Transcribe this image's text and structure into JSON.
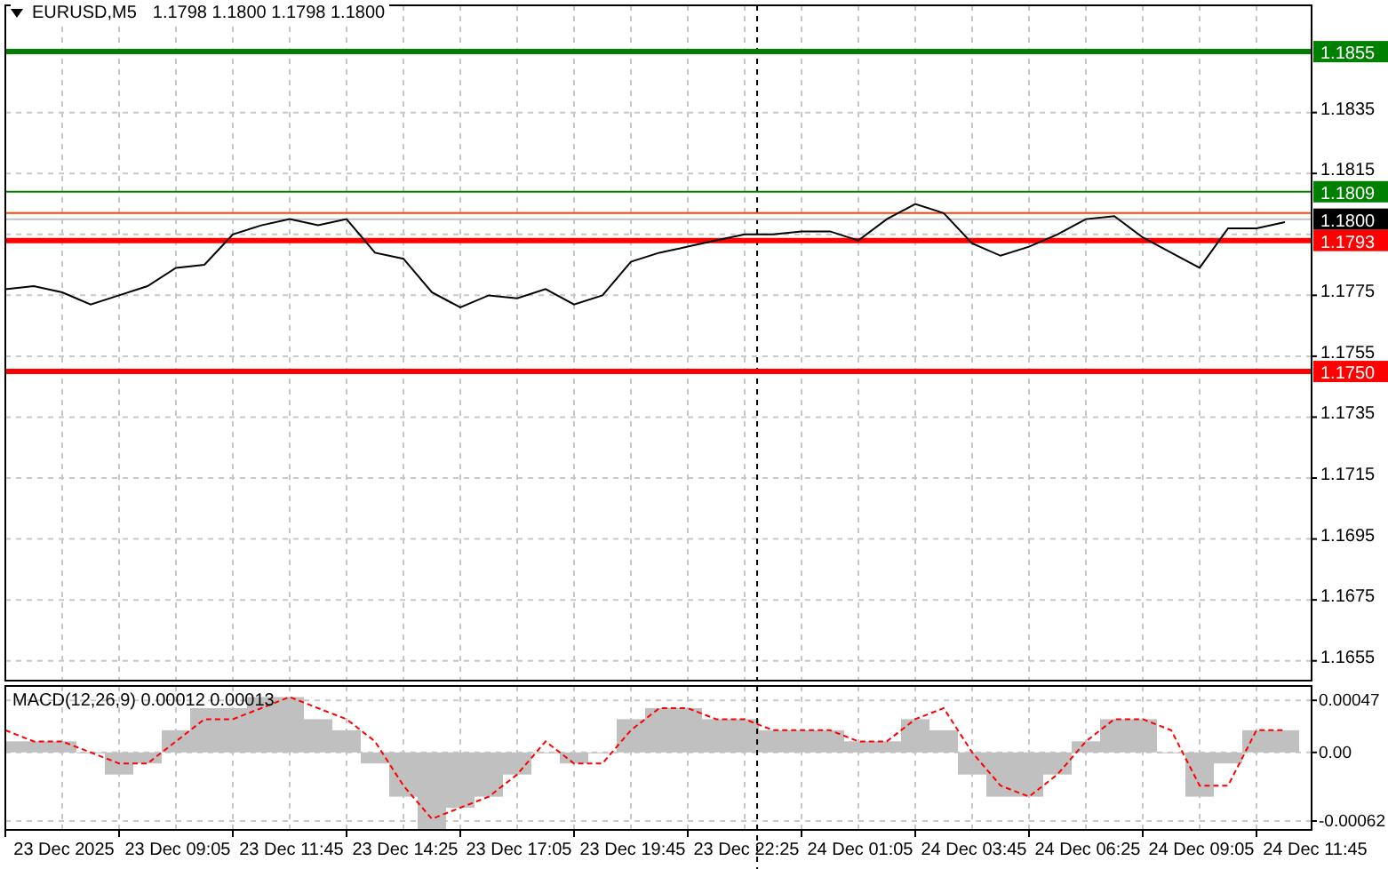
{
  "main": {
    "header": {
      "symbol": "EURUSD,M5",
      "quote": "1.1798 1.1800 1.1798 1.1800"
    },
    "price_labels": [
      {
        "text": "1.1855",
        "color": "#008000"
      },
      {
        "text": "1.1809",
        "color": "#008000"
      },
      {
        "text": "1.1800",
        "color": "#000000"
      },
      {
        "text": "1.1793",
        "color": "#ff0000"
      },
      {
        "text": "1.1750",
        "color": "#ff0000"
      }
    ],
    "chart_data": {
      "type": "line",
      "grid": true,
      "ylim": [
        1.16485,
        1.18702
      ],
      "yticks": [
        1.1835,
        1.1815,
        1.1775,
        1.1755,
        1.1735,
        1.1715,
        1.1695,
        1.1675,
        1.1655
      ],
      "ref_lines": [
        {
          "axis": "y",
          "value": 1.1855,
          "color": "#008000"
        },
        {
          "axis": "y",
          "value": 1.1809,
          "color": "#008000"
        },
        {
          "axis": "y",
          "value": 1.1802,
          "color": "#ff4500"
        },
        {
          "axis": "y",
          "value": 1.18,
          "color": "#c0c0c0"
        },
        {
          "axis": "y",
          "value": 1.1793,
          "color": "#ff0000"
        },
        {
          "axis": "y",
          "value": 1.175,
          "color": "#ff0000"
        }
      ],
      "categories": [
        null,
        null,
        null,
        null,
        null,
        null,
        null,
        null,
        null,
        null,
        null,
        null,
        null,
        null,
        null,
        null,
        null,
        null,
        null,
        null,
        null,
        null,
        null,
        null,
        null,
        null,
        null,
        null,
        null,
        null,
        null,
        null,
        null,
        null,
        null,
        null,
        null,
        null,
        null,
        null,
        null,
        null,
        null,
        null,
        null,
        null
      ],
      "series": [
        {
          "color": "#000000",
          "values": [
            1.1777,
            1.1778,
            1.1776,
            1.1772,
            1.1775,
            1.1778,
            1.1784,
            1.1785,
            1.1795,
            1.1798,
            1.18,
            1.1798,
            1.18,
            1.1789,
            1.1787,
            1.1776,
            1.1771,
            1.1775,
            1.1774,
            1.1777,
            1.1772,
            1.1775,
            1.1786,
            1.1789,
            1.1791,
            1.1793,
            1.1795,
            1.1795,
            1.1796,
            1.1796,
            1.1793,
            1.18,
            1.1805,
            1.1802,
            1.1792,
            1.1788,
            1.1791,
            1.1795,
            1.18,
            1.1801,
            1.1794,
            1.1789,
            1.1784,
            1.1797,
            1.1797,
            1.1799
          ]
        }
      ]
    }
  },
  "indicator": {
    "chart_data": {
      "type": "bar",
      "grid": true,
      "title": "MACD(12,26,9) 0.00012 0.00013",
      "ylim": [
        -0.0007,
        0.0006
      ],
      "yticks": [
        {
          "value": 0.00047,
          "label": "0.00047"
        },
        {
          "value": 0,
          "label": "0.00"
        },
        {
          "value": -0.00062,
          "label": "-0.00062"
        }
      ],
      "categories": [
        null,
        null,
        "23 Dec 2025",
        null,
        null,
        null,
        "23 Dec 09:05",
        null,
        null,
        null,
        "23 Dec 11:45",
        null,
        null,
        null,
        "23 Dec 14:25",
        null,
        null,
        null,
        "23 Dec 17:05",
        null,
        null,
        null,
        "23 Dec 19:45",
        null,
        null,
        null,
        "23 Dec 22:25",
        null,
        null,
        null,
        "24 Dec 01:05",
        null,
        null,
        null,
        "24 Dec 03:45",
        null,
        null,
        null,
        "24 Dec 06:25",
        null,
        null,
        null,
        "24 Dec 09:05",
        null,
        null,
        null,
        "24 Dec 11:45"
      ],
      "series": [
        {
          "color": "#c0c0c0",
          "values": [
            0.0001,
            0.0001,
            0.0001,
            0,
            -0.0002,
            -0.0001,
            0.0002,
            0.0004,
            0.0004,
            0.0005,
            0.0005,
            0.0003,
            0.0002,
            -0.0001,
            -0.0004,
            -0.0007,
            -0.0005,
            -0.0004,
            -0.0002,
            0,
            -0.0001,
            0,
            0.0003,
            0.0004,
            0.0004,
            0.0003,
            0.0003,
            0.0002,
            0.0002,
            0.0002,
            0.0001,
            0.0001,
            0.0003,
            0.0002,
            -0.0002,
            -0.0004,
            -0.0004,
            -0.0002,
            0.0001,
            0.0003,
            0.0003,
            0,
            -0.0004,
            -0.0001,
            0.0002,
            0.0002,
            null
          ]
        },
        {
          "type": "line",
          "line_style": "dashed",
          "color": "#ff0000",
          "values": [
            0.0002,
            0.0001,
            0.0001,
            0,
            -0.0001,
            -0.0001,
            0.0001,
            0.0003,
            0.0003,
            0.0004,
            0.0005,
            0.0004,
            0.0003,
            0.0001,
            -0.0003,
            -0.0006,
            -0.0005,
            -0.0004,
            -0.0002,
            0.0001,
            -0.0001,
            -0.0001,
            0.0002,
            0.0004,
            0.0004,
            0.0003,
            0.0003,
            0.0002,
            0.0002,
            0.0002,
            0.0001,
            0.0001,
            0.0003,
            0.0004,
            0,
            -0.0003,
            -0.0004,
            -0.0002,
            0.0001,
            0.0003,
            0.0003,
            0.0002,
            -0.0003,
            -0.0003,
            0.0002,
            0.0002,
            null
          ]
        }
      ]
    }
  }
}
